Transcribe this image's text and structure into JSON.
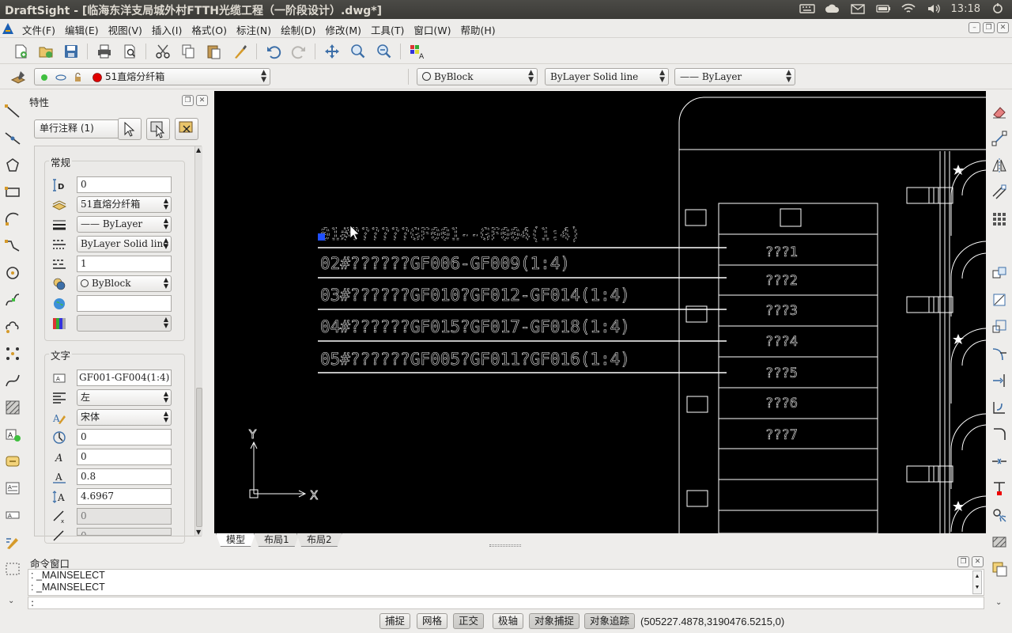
{
  "window": {
    "title": "DraftSight - [临海东洋支局城外村FTTH光缆工程（一阶段设计）.dwg*]",
    "clock": "13:18"
  },
  "menu": [
    {
      "label": "文件(F)"
    },
    {
      "label": "编辑(E)"
    },
    {
      "label": "视图(V)"
    },
    {
      "label": "插入(I)"
    },
    {
      "label": "格式(O)"
    },
    {
      "label": "标注(N)"
    },
    {
      "label": "绘制(D)"
    },
    {
      "label": "修改(M)"
    },
    {
      "label": "工具(T)"
    },
    {
      "label": "窗口(W)"
    },
    {
      "label": "帮助(H)"
    }
  ],
  "layer_toolbar": {
    "layer": "51直熔分纤箱",
    "color": "ByBlock",
    "linetype": "ByLayer      Solid line",
    "lineweight": "—— ByLayer",
    "layer_color": "#e00000"
  },
  "properties": {
    "title": "特性",
    "selection": "单行注释 (1)",
    "general": {
      "label": "常规",
      "id": "0",
      "layer": "51直熔分纤箱",
      "lineweight": "—— ByLayer",
      "linetype": "ByLayer      Solid line",
      "linetype_scale": "1",
      "color": "ByBlock",
      "hyperlink": "",
      "transparency": ""
    },
    "text": {
      "label": "文字",
      "contents": "GF001-GF004(1:4)",
      "justify": "左",
      "font": "宋体",
      "rotation": "0",
      "oblique": "0",
      "width_factor": "0.8",
      "height": "4.6967",
      "pos_x": "0",
      "pos_y": "0"
    }
  },
  "drawing": {
    "lines": [
      "01#??????GF001--GF004(1:4)",
      "02#??????GF006-GF009(1:4)",
      "03#??????GF010?GF012-GF014(1:4)",
      "04#??????GF015?GF017-GF018(1:4)",
      "05#??????GF005?GF011?GF016(1:4)"
    ],
    "table_rows": [
      "???1",
      "???2",
      "???3",
      "???4",
      "???5",
      "???6",
      "???7"
    ],
    "axis_x": "X",
    "axis_y": "Y"
  },
  "layout_tabs": [
    {
      "label": "模型",
      "active": true
    },
    {
      "label": "布局1",
      "active": false
    },
    {
      "label": "布局2",
      "active": false
    }
  ],
  "command": {
    "title": "命令窗口",
    "history": [
      ": _MAINSELECT",
      ": _MAINSELECT"
    ],
    "prompt": ":"
  },
  "status": {
    "buttons": [
      {
        "label": "捕捉",
        "on": false
      },
      {
        "label": "网格",
        "on": false
      },
      {
        "label": "正交",
        "on": true
      },
      {
        "label": "极轴",
        "on": false
      },
      {
        "label": "对象捕捉",
        "on": true
      },
      {
        "label": "对象追踪",
        "on": true
      }
    ],
    "coordinates": "(505227.4878,3190476.5215,0)"
  }
}
